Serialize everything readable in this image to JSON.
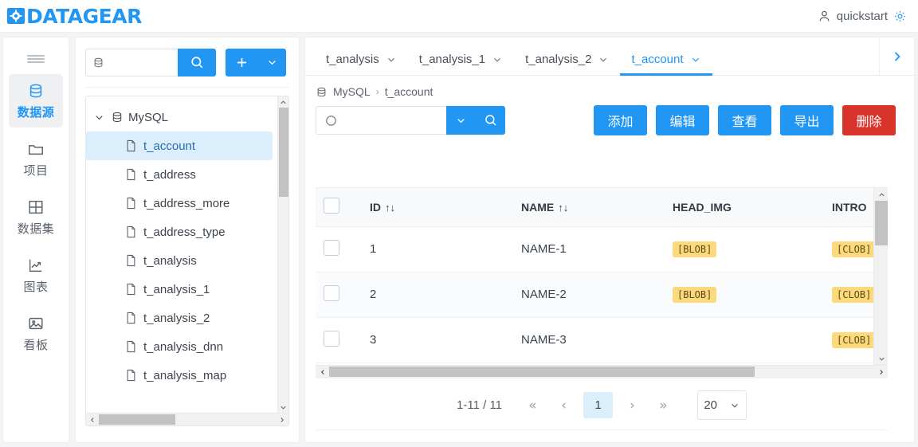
{
  "header": {
    "logo_text": "DATAGEAR",
    "logo_icon": "gear-icon",
    "user_name": "quickstart",
    "user_icon": "user-icon",
    "settings_icon": "gear-icon",
    "accent_color": "#2196f3"
  },
  "rail": {
    "menu_icon": "hamburger-icon",
    "items": [
      {
        "label": "数据源",
        "icon": "database-icon",
        "active": true
      },
      {
        "label": "项目",
        "icon": "folder-icon",
        "active": false
      },
      {
        "label": "数据集",
        "icon": "grid-icon",
        "active": false
      },
      {
        "label": "图表",
        "icon": "chart-line-icon",
        "active": false
      },
      {
        "label": "看板",
        "icon": "image-icon",
        "active": false
      }
    ]
  },
  "tree_panel": {
    "search": {
      "value": "",
      "placeholder": "",
      "icon": "database-icon"
    },
    "search_button_icon": "search-icon",
    "add_button_icon": "plus-icon",
    "add_dropdown_icon": "chevron-down-icon",
    "root": {
      "label": "MySQL",
      "icon": "database-icon",
      "expanded": true
    },
    "nodes": [
      {
        "label": "t_account",
        "selected": true
      },
      {
        "label": "t_address",
        "selected": false
      },
      {
        "label": "t_address_more",
        "selected": false
      },
      {
        "label": "t_address_type",
        "selected": false
      },
      {
        "label": "t_analysis",
        "selected": false
      },
      {
        "label": "t_analysis_1",
        "selected": false
      },
      {
        "label": "t_analysis_2",
        "selected": false
      },
      {
        "label": "t_analysis_dnn",
        "selected": false
      },
      {
        "label": "t_analysis_map",
        "selected": false
      }
    ]
  },
  "main": {
    "tabs": [
      {
        "label": "t_analysis",
        "active": false
      },
      {
        "label": "t_analysis_1",
        "active": false
      },
      {
        "label": "t_analysis_2",
        "active": false
      },
      {
        "label": "t_account",
        "active": true
      }
    ],
    "tab_next_icon": "chevron-right-icon",
    "breadcrumb": {
      "icon": "database-icon",
      "root": "MySQL",
      "separator": "›",
      "current": "t_account"
    },
    "filter": {
      "value": "",
      "placeholder": "",
      "icon": "circle-icon"
    },
    "filter_dropdown_icon": "chevron-down-icon",
    "filter_search_icon": "search-icon",
    "buttons": [
      {
        "label": "添加",
        "style": "primary"
      },
      {
        "label": "编辑",
        "style": "primary"
      },
      {
        "label": "查看",
        "style": "primary"
      },
      {
        "label": "导出",
        "style": "primary"
      },
      {
        "label": "删除",
        "style": "danger"
      }
    ],
    "table": {
      "columns": [
        {
          "key": "cb",
          "label": "",
          "sortable": false
        },
        {
          "key": "id",
          "label": "ID",
          "sortable": true
        },
        {
          "key": "name",
          "label": "NAME",
          "sortable": true
        },
        {
          "key": "head_img",
          "label": "HEAD_IMG",
          "sortable": false
        },
        {
          "key": "intro",
          "label": "INTRO",
          "sortable": false
        }
      ],
      "sort_icon": "↑↓",
      "rows": [
        {
          "id": "1",
          "name": "NAME-1",
          "head_img": "[BLOB]",
          "intro": "[CLOB]"
        },
        {
          "id": "2",
          "name": "NAME-2",
          "head_img": "[BLOB]",
          "intro": "[CLOB]"
        },
        {
          "id": "3",
          "name": "NAME-3",
          "head_img": "",
          "intro": "[CLOB]"
        }
      ]
    },
    "pagination": {
      "range_text": "1-11 / 11",
      "first_label": "«",
      "prev_label": "‹",
      "current_page": "1",
      "next_label": "›",
      "last_label": "»",
      "page_size": "20",
      "page_size_icon": "chevron-down-icon"
    }
  }
}
